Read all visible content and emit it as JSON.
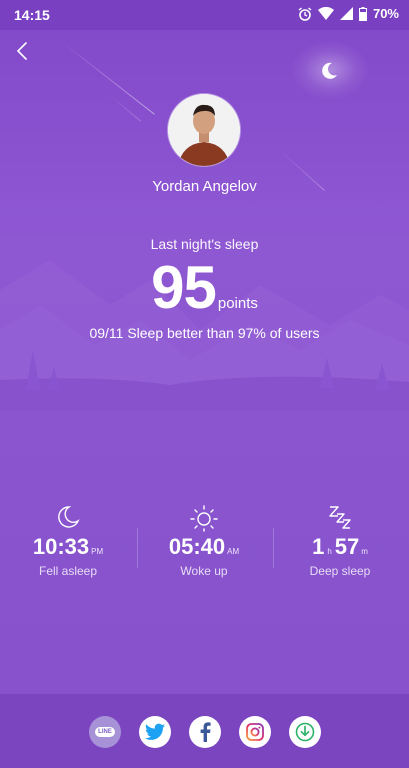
{
  "status_bar": {
    "time": "14:15",
    "battery": "70%"
  },
  "profile": {
    "name": "Yordan Angelov"
  },
  "sleep": {
    "label": "Last night's sleep",
    "score": "95",
    "score_unit": "points",
    "comparison": "09/11 Sleep better than 97% of users"
  },
  "stats": [
    {
      "icon": "moon-icon",
      "value": "10:33",
      "suffix": "PM",
      "label": "Fell asleep"
    },
    {
      "icon": "sun-icon",
      "value": "05:40",
      "suffix": "AM",
      "label": "Woke up"
    },
    {
      "icon": "zzz-icon",
      "value_hours": "1",
      "hours_unit": "h",
      "value_minutes": "57",
      "minutes_unit": "m",
      "label": "Deep sleep"
    }
  ],
  "share": {
    "line_label": "LINE",
    "buttons": [
      "line-icon",
      "twitter-icon",
      "facebook-icon",
      "instagram-icon",
      "download-icon"
    ]
  },
  "colors": {
    "background": "#8a52cf",
    "status_bar": "#7a40c2",
    "share_bar": "#7b45c0",
    "twitter": "#1da1f2",
    "facebook": "#3b5998",
    "download": "#2fb36a"
  }
}
